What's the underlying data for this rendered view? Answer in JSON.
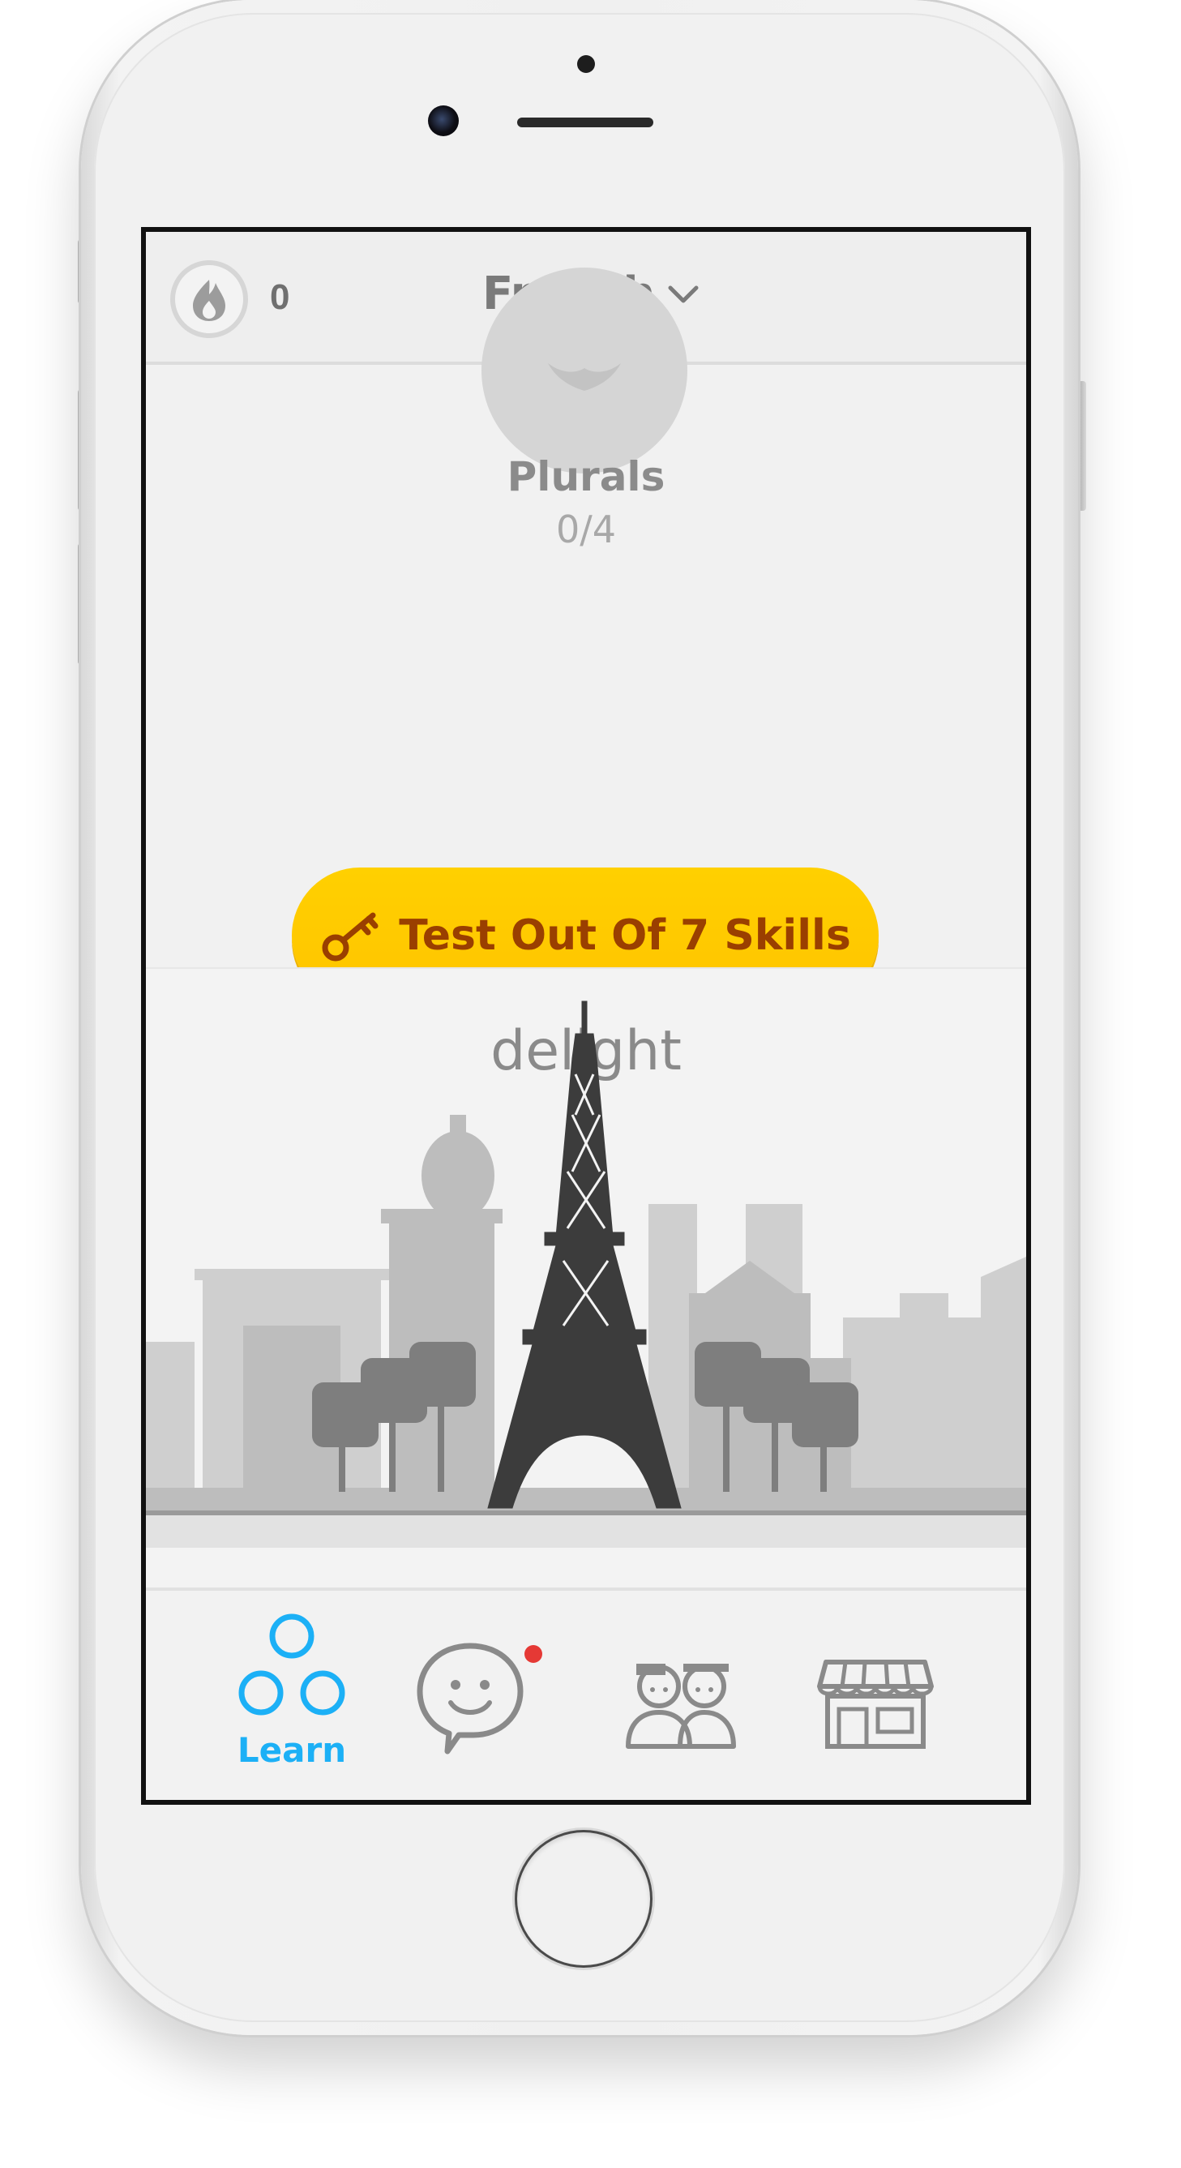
{
  "header": {
    "streak_count": "0",
    "language": "French"
  },
  "skill": {
    "name": "Plurals",
    "progress": "0/4"
  },
  "test_out": {
    "label": "Test Out Of 7 Skills"
  },
  "word_of_day": {
    "word": "delight"
  },
  "tabs": [
    {
      "name": "learn",
      "label": "Learn",
      "active": true,
      "icon": "learn-icon"
    },
    {
      "name": "discuss",
      "label": "",
      "active": false,
      "icon": "chat-icon",
      "badge": true
    },
    {
      "name": "clubs",
      "label": "",
      "active": false,
      "icon": "clubs-icon"
    },
    {
      "name": "shop",
      "label": "",
      "active": false,
      "icon": "shop-icon"
    }
  ],
  "colors": {
    "accent": "#1cb0f6",
    "button": "#ffc800",
    "button_text": "#9a3f00",
    "badge": "#e53935"
  }
}
